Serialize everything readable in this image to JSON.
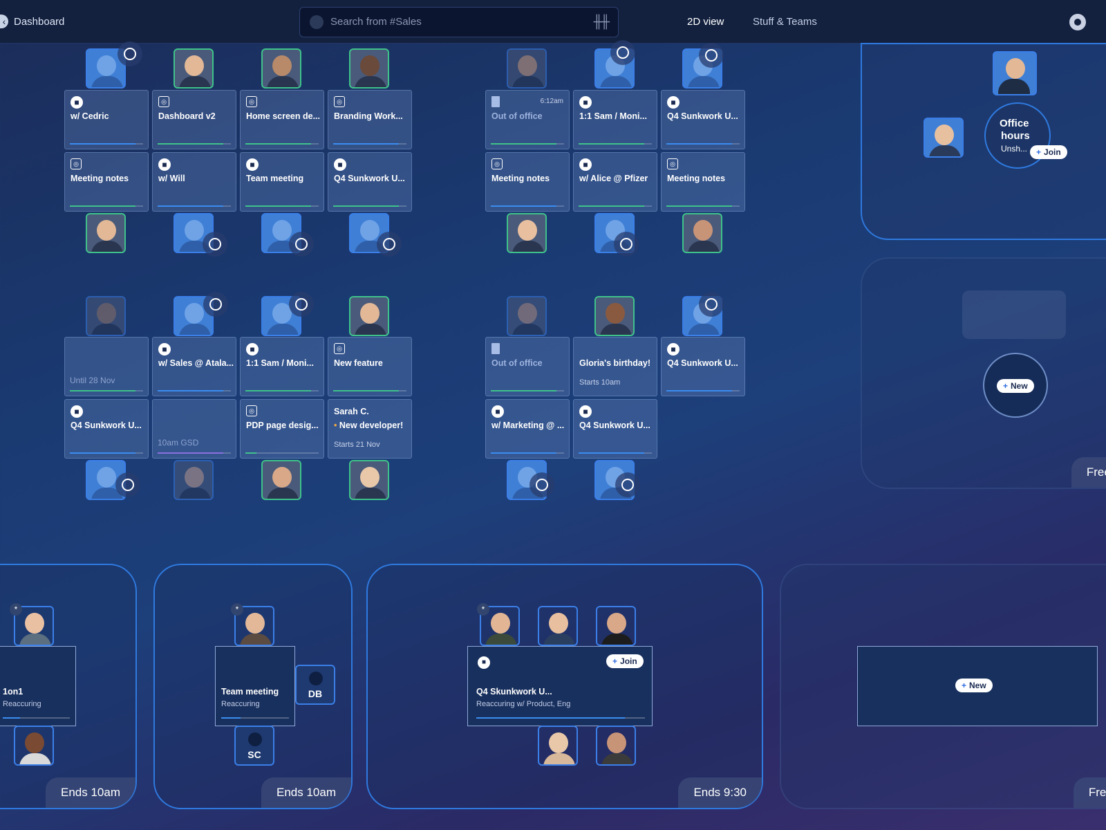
{
  "topbar": {
    "back_label": "Dashboard",
    "search_placeholder": "Search from #Sales",
    "nav_2d": "2D view",
    "nav_stuff": "Stuff & Teams"
  },
  "cards": [
    {
      "id": "c1",
      "icon": "video-icon",
      "title": "w/ Cedric"
    },
    {
      "id": "c2",
      "icon": "screen-icon",
      "title": "Dashboard v2"
    },
    {
      "id": "c3",
      "icon": "screen-icon",
      "title": "Home screen de..."
    },
    {
      "id": "c4",
      "icon": "screen-icon",
      "title": "Branding Work..."
    },
    {
      "id": "c5",
      "icon": "screen-icon",
      "title": "Meeting notes"
    },
    {
      "id": "c6",
      "icon": "video-icon",
      "title": "w/ Will"
    },
    {
      "id": "c7",
      "icon": "video-icon",
      "title": "Team meeting"
    },
    {
      "id": "c8",
      "icon": "video-icon",
      "title": "Q4 Sunkwork U..."
    },
    {
      "id": "c9",
      "icon": "door-icon",
      "title": "Out of office",
      "time": "6:12am"
    },
    {
      "id": "c10",
      "icon": "video-icon",
      "title": "1:1 Sam / Moni..."
    },
    {
      "id": "c11",
      "icon": "video-icon",
      "title": "Q4 Sunkwork U..."
    },
    {
      "id": "c12",
      "icon": "screen-icon",
      "title": "Meeting notes"
    },
    {
      "id": "c13",
      "icon": "video-icon",
      "title": "w/ Alice @ Pfizer"
    },
    {
      "id": "c14",
      "icon": "screen-icon",
      "title": "Meeting notes"
    },
    {
      "id": "c15",
      "title": "",
      "low": "Until 28 Nov"
    },
    {
      "id": "c16",
      "icon": "video-icon",
      "title": "w/ Sales @ Atala..."
    },
    {
      "id": "c17",
      "icon": "video-icon",
      "title": "1:1 Sam / Moni..."
    },
    {
      "id": "c18",
      "icon": "screen-icon",
      "title": "New feature"
    },
    {
      "id": "c19",
      "icon": "video-icon",
      "title": "Q4 Sunkwork U..."
    },
    {
      "id": "c20",
      "title": "",
      "low": "10am GSD"
    },
    {
      "id": "c21",
      "icon": "screen-icon",
      "title": "PDP page desig..."
    },
    {
      "id": "c22",
      "title": "Sarah C.",
      "title2": "New developer!",
      "sub": "Starts 21 Nov"
    },
    {
      "id": "c23",
      "icon": "door-icon",
      "title": "Out of office"
    },
    {
      "id": "c24",
      "title": "Gloria's birthday!",
      "sub": "Starts 10am"
    },
    {
      "id": "c25",
      "icon": "video-icon",
      "title": "Q4 Sunkwork U..."
    },
    {
      "id": "c26",
      "icon": "video-icon",
      "title": "w/ Marketing @ ..."
    },
    {
      "id": "c27",
      "icon": "video-icon",
      "title": "Q4 Sunkwork U..."
    }
  ],
  "office_hours": {
    "title_1": "Office",
    "title_2": "hours",
    "sub": "Unsh...",
    "join": "Join"
  },
  "rooms": {
    "r1": {
      "title": "1on1",
      "sub": "Reaccuring",
      "ends": "Ends 10am"
    },
    "r2": {
      "title": "Team meeting",
      "sub": "Reaccuring",
      "ends": "Ends 10am",
      "init1": "DB",
      "init2": "SC"
    },
    "r3": {
      "title": "Q4 Skunkwork U...",
      "sub": "Reaccuring w/ Product, Eng",
      "ends": "Ends 9:30",
      "join": "Join"
    },
    "r4": {
      "new": "New",
      "free": "Free u"
    },
    "side": {
      "new": "New",
      "free": "Free u",
      "edge": "E"
    }
  },
  "colors": {
    "accent": "#2f7ae0",
    "green": "#3fc28a",
    "blue_bar": "#3b8cf0",
    "purple": "#8b6fe0"
  }
}
